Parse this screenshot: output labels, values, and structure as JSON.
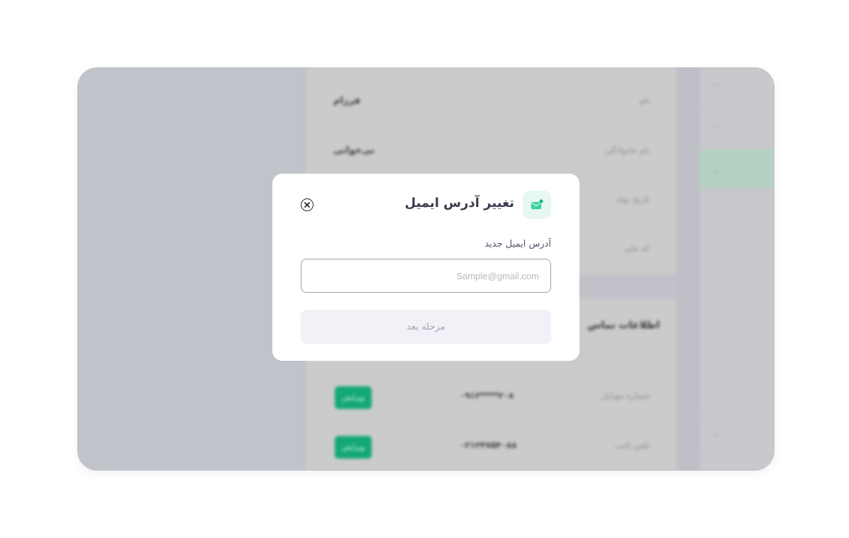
{
  "background": {
    "personal_rows": [
      {
        "label": "نام",
        "value": "فرزام"
      },
      {
        "label": "نام خانوادگی",
        "value": "نی‌خوانی"
      },
      {
        "label": "تاریخ تولد",
        "value": ""
      },
      {
        "label": "کد ملی",
        "value": ""
      }
    ],
    "contact_title": "اطلاعات تماس",
    "contact_rows": [
      {
        "label": "شماره موبایل",
        "value": "۰۹۱۲****۲۰۸",
        "badge": "ویرایش"
      },
      {
        "label": "تلفن ثابت",
        "value": "۰۲۱۲۴۷۵۴۰۸۸",
        "badge": "ویرایش"
      }
    ],
    "accordion": [
      "chevron-down",
      "chevron-down",
      "chevron-up",
      "chevron-down"
    ]
  },
  "modal": {
    "title": "تغییر آدرس ایمیل",
    "field_label": "آدرس ایمیل جدید",
    "email_placeholder": "Sample@gmail.com",
    "email_value": "",
    "next_button": "مرحله بعد"
  },
  "colors": {
    "accent": "#13a877",
    "icon_bg": "#e6f8f1",
    "button_disabled_bg": "#f1f2f7"
  }
}
